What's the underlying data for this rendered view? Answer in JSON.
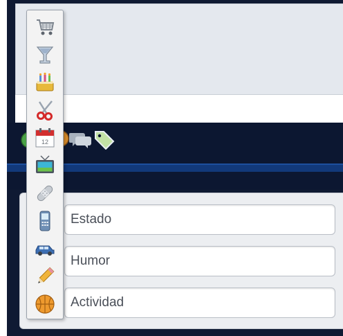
{
  "status_fields": {
    "estado_label": "Estado",
    "humor_label": "Humor",
    "actividad_label": "Actividad"
  },
  "icon_picker": {
    "icons": [
      "shopping-cart-icon",
      "cocktail-glass-icon",
      "birthday-cake-icon",
      "scissors-icon",
      "calendar-icon",
      "tv-icon",
      "bandage-icon",
      "mobile-phone-icon",
      "car-icon",
      "pencil-icon",
      "basketball-icon"
    ],
    "calendar_day": "12"
  },
  "toolbar": {
    "icons": [
      "smiley-icon",
      "chat-bubbles-icon",
      "tag-icon"
    ]
  },
  "colors": {
    "frame_dark": "#0f1a33",
    "stripe_blue": "#12397a",
    "panel_bg": "#e4e8ee",
    "field_text": "#4a4f58"
  }
}
